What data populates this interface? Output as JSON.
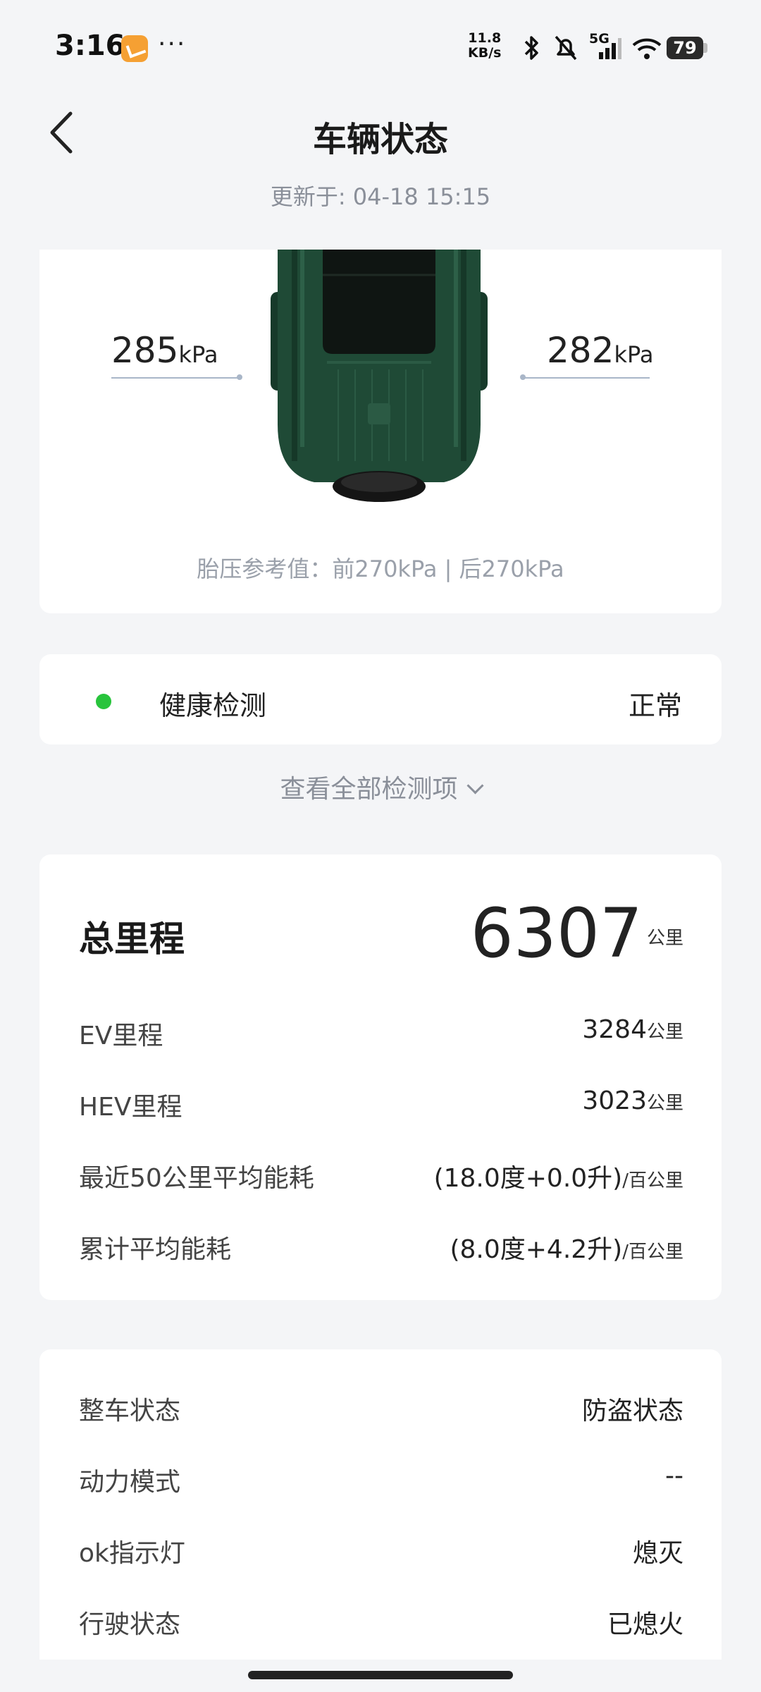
{
  "status_bar": {
    "time": "3:16",
    "dots": "···",
    "net_speed_value": "11.8",
    "net_speed_unit": "KB/s",
    "network": "5G",
    "battery": "79"
  },
  "header": {
    "title": "车辆状态",
    "updated": "更新于: 04-18 15:15"
  },
  "tires": {
    "left_value": "285",
    "right_value": "282",
    "unit": "kPa",
    "reference": "胎压参考值：前270kPa | 后270kPa",
    "car_color": "#1f4a36"
  },
  "health": {
    "label": "健康检测",
    "status": "正常",
    "status_color": "#28c43c"
  },
  "view_all": "查看全部检测项",
  "mileage": {
    "total_label": "总里程",
    "total_value": "6307",
    "unit": "公里",
    "rows": [
      {
        "label": "EV里程",
        "value": "3284",
        "unit": "公里"
      },
      {
        "label": "HEV里程",
        "value": "3023",
        "unit": "公里"
      },
      {
        "label": "最近50公里平均能耗",
        "value": "(18.0度+0.0升)",
        "unit": "/百公里"
      },
      {
        "label": "累计平均能耗",
        "value": "(8.0度+4.2升)",
        "unit": "/百公里"
      }
    ]
  },
  "vehicle_state": {
    "rows": [
      {
        "label": "整车状态",
        "value": "防盗状态"
      },
      {
        "label": "动力模式",
        "value": "--"
      },
      {
        "label": "ok指示灯",
        "value": "熄灭"
      },
      {
        "label": "行驶状态",
        "value": "已熄火"
      }
    ]
  }
}
